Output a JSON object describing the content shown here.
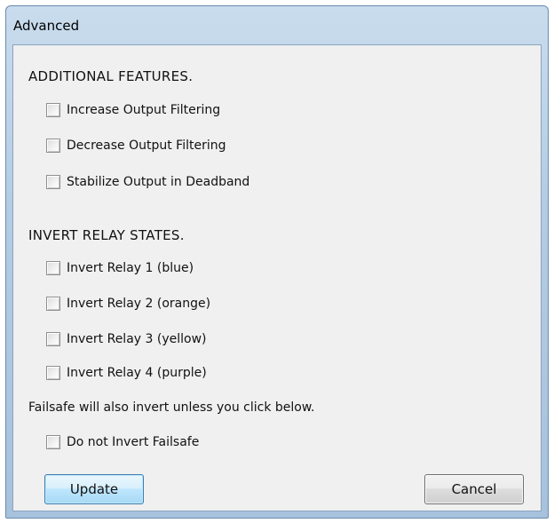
{
  "window": {
    "title": "Advanced"
  },
  "additional_features": {
    "heading": "ADDITIONAL FEATURES.",
    "options": [
      {
        "label": "Increase Output Filtering",
        "checked": false
      },
      {
        "label": "Decrease Output Filtering",
        "checked": false
      },
      {
        "label": "Stabilize Output in Deadband",
        "checked": false
      }
    ]
  },
  "invert_relay_states": {
    "heading": "INVERT RELAY STATES.",
    "options": [
      {
        "label": "Invert Relay 1 (blue)",
        "checked": false
      },
      {
        "label": "Invert Relay 2 (orange)",
        "checked": false
      },
      {
        "label": "Invert Relay 3 (yellow)",
        "checked": false
      },
      {
        "label": "Invert Relay 4 (purple)",
        "checked": false
      }
    ]
  },
  "failsafe": {
    "note": "Failsafe will also invert unless you click below.",
    "option": {
      "label": "Do not Invert Failsafe",
      "checked": false
    }
  },
  "buttons": {
    "update_label": "Update",
    "cancel_label": "Cancel"
  }
}
